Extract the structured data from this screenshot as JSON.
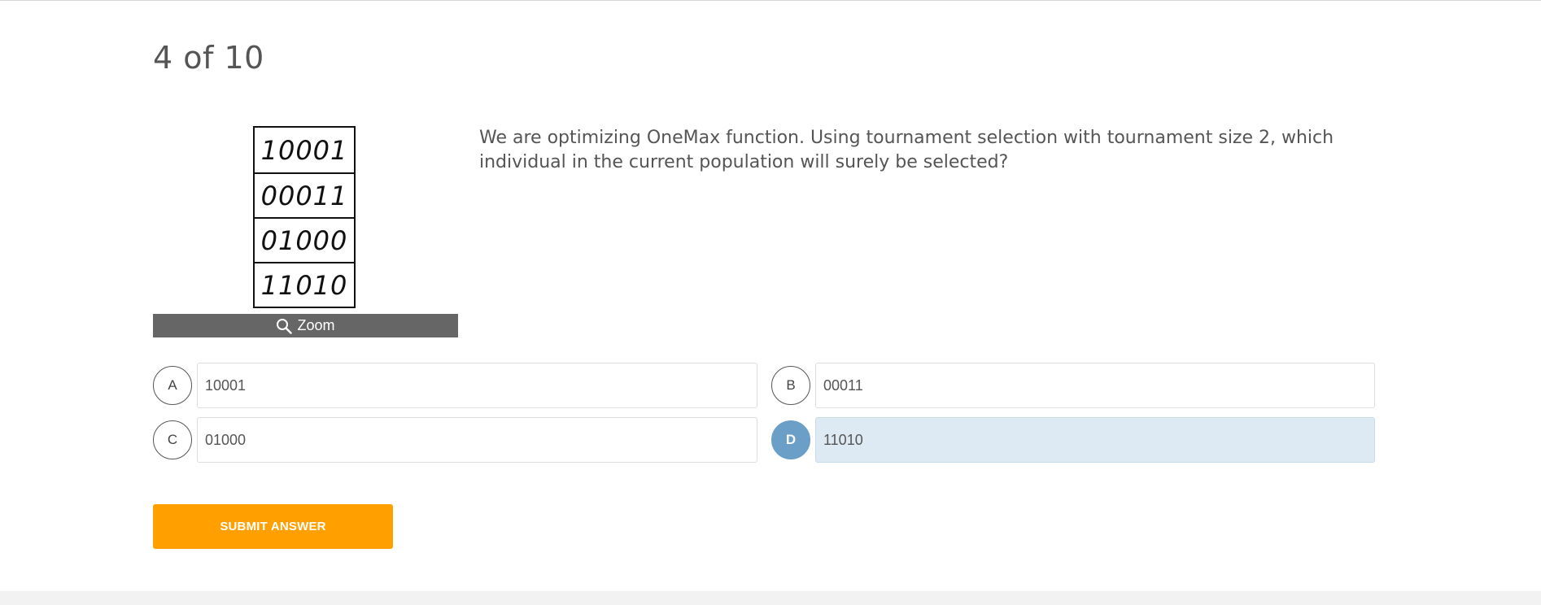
{
  "quiz": {
    "progress": "4 of 10",
    "question": "We are optimizing OneMax function. Using tournament selection with tournament size 2, which individual in the current population will surely be selected?",
    "figure": {
      "population": [
        "10001",
        "00011",
        "01000",
        "11010"
      ],
      "zoom_label": "Zoom",
      "zoom_icon": "magnifier-icon"
    },
    "options": [
      {
        "letter": "A",
        "text": "10001"
      },
      {
        "letter": "B",
        "text": "00011"
      },
      {
        "letter": "C",
        "text": "01000"
      },
      {
        "letter": "D",
        "text": "11010",
        "selected": true
      }
    ],
    "submit_label": "SUBMIT ANSWER"
  },
  "colors": {
    "accent_orange": "#ffa000",
    "selected_blue": "#6b9fc7",
    "selected_fill": "#deeaf3",
    "zoom_bar": "#666666"
  }
}
